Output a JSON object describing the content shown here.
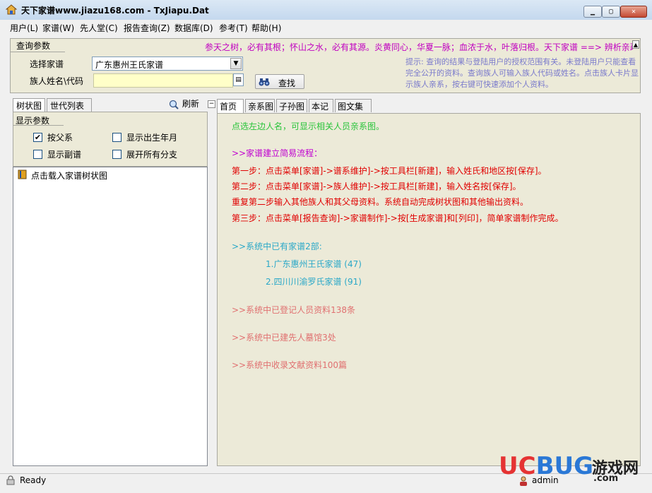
{
  "window": {
    "title": "天下家谱www.jiazu168.com - TxJiapu.Dat",
    "minimize": "0",
    "maximize": "1",
    "close": "r"
  },
  "menu": [
    "用户(L)",
    "家谱(W)",
    "先人堂(C)",
    "报告查询(Z)",
    "数据库(D)",
    "参考(T)",
    "帮助(H)"
  ],
  "query": {
    "title": "查询参数",
    "marquee": "参天之树，必有其根；怀山之水，必有其源。炎黄同心，华夏一脉；血浓于水，叶落归根。天下家谱 ==> 辨析亲疏",
    "genealogy_label": "选择家谱",
    "genealogy_value": "广东惠州王氏家谱",
    "member_label": "族人姓名\\代码",
    "member_value": "",
    "search_label": "查找",
    "hint": "提示: 查询的结果与登陆用户的授权范围有关。未登陆用户只能查看完全公开的资料。查询族人可输入族人代码或姓名。点击族人卡片显示族人亲系，按右键可快速添加个人资料。"
  },
  "left": {
    "tabs": [
      "树状图",
      "世代列表"
    ],
    "refresh_label": "刷新",
    "display_title": "显示参数",
    "options": [
      {
        "label": "按父系",
        "checked": true
      },
      {
        "label": "显示出生年月",
        "checked": false
      },
      {
        "label": "显示副谱",
        "checked": false
      },
      {
        "label": "展开所有分支",
        "checked": false
      }
    ],
    "tree_node": "点击载入家谱树状图"
  },
  "right": {
    "tabs": [
      "首页",
      "亲系图",
      "子孙图",
      "本记",
      "图文集"
    ],
    "intro": "点选左边人名，可显示相关人员亲系图。",
    "flow_title": ">>家谱建立简易流程：",
    "steps": [
      "第一步：点击菜单[家谱]->谱系维护]->按工具栏[新建]，输入姓氏和地区按[保存]。",
      "第二步：点击菜单[家谱]->族人维护]->按工具栏[新建]，输入姓名按[保存]。",
      "重复第二步输入其他族人和其父母资料。系统自动完成树状图和其他输出资料。",
      "第三步：点击菜单[报告查询]->家谱制作]->按[生成家谱]和[列印]，简单家谱制作完成。"
    ],
    "genealogy_count": ">>系统中已有家谱2部:",
    "genealogies": [
      "1.广东惠州王氏家谱 (47)",
      "2.四川川渝罗氏家谱 (91)"
    ],
    "persons": ">>系统中已登记人员资料138条",
    "halls": ">>系统中已建先人墓馆3处",
    "docs": ">>系统中收录文献资料100篇"
  },
  "status": {
    "text": "Ready",
    "user": "admin"
  },
  "watermark": {
    "brand_uc": "UC",
    "brand_bug": "BUG",
    "cn": "游戏网",
    "com": ".com"
  },
  "colors": {
    "panel_bg": "#ecead8",
    "marquee": "#c000c0",
    "intro": "#29c43a",
    "steps": "#e00000",
    "genealogy_list": "#2aa8c8",
    "stats": "#e07070"
  }
}
